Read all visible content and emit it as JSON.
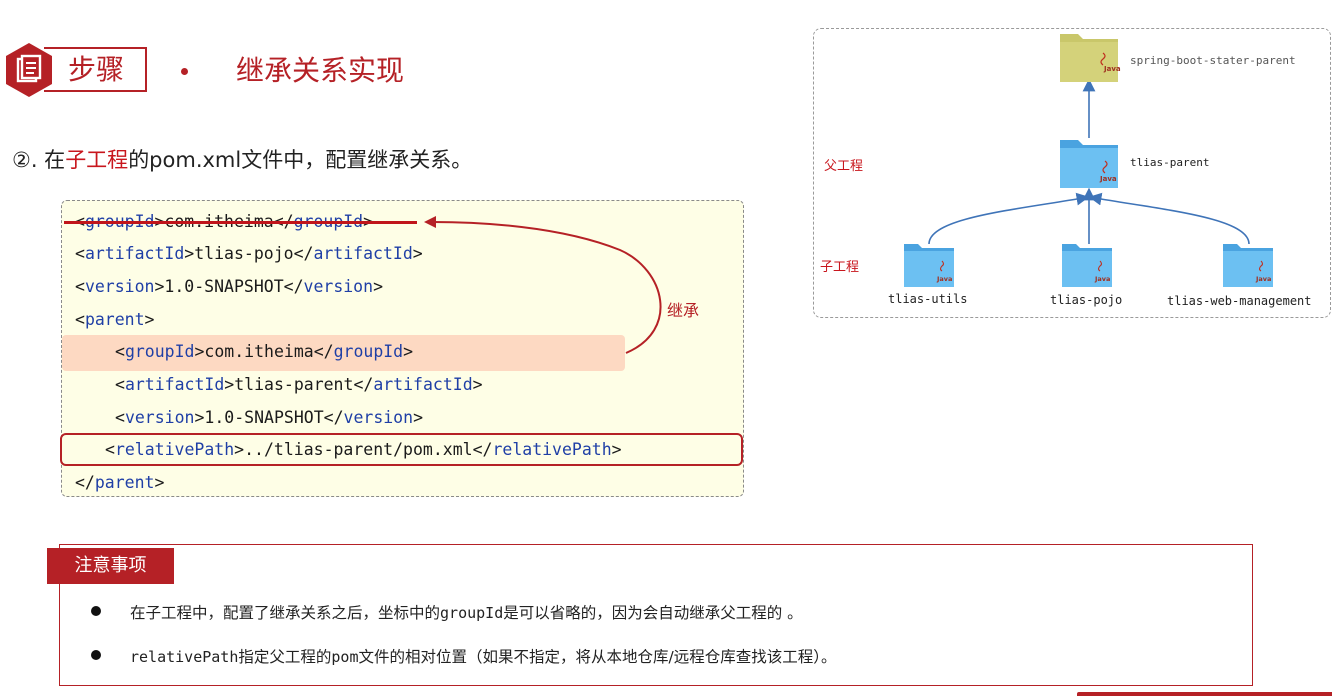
{
  "header": {
    "step_label": "步骤",
    "title": "继承关系实现"
  },
  "instruction": {
    "prefix": "②. 在",
    "highlight": "子工程",
    "suffix": "的pom.xml文件中，配置继承关系。"
  },
  "code": {
    "lines": [
      {
        "open": "groupId",
        "text": "com.itheima"
      },
      {
        "open": "artifactId",
        "text": "tlias-pojo"
      },
      {
        "open": "version",
        "text": "1.0-SNAPSHOT"
      },
      {
        "open": "parent",
        "text": ""
      },
      {
        "open": "groupId",
        "text": "com.itheima"
      },
      {
        "open": "artifactId",
        "text": "tlias-parent"
      },
      {
        "open": "version",
        "text": "1.0-SNAPSHOT"
      },
      {
        "open": "relativePath",
        "text": "../tlias-parent/pom.xml"
      },
      {
        "open": "parent",
        "text": ""
      }
    ],
    "inherit_label": "继承"
  },
  "diagram": {
    "root": "spring-boot-stater-parent",
    "parent": "tlias-parent",
    "parent_group_label": "父工程",
    "child_group_label": "子工程",
    "children": [
      "tlias-utils",
      "tlias-pojo",
      "tlias-web-management"
    ],
    "java_badge": "Java",
    "colors": {
      "root_folder": "#c9c76a",
      "folder": "#5fb5ec",
      "arrow": "#3f74b8"
    }
  },
  "notes": {
    "title": "注意事项",
    "items": [
      {
        "a": "在子工程中，配置了继承关系之后，坐标中的",
        "code": "groupId",
        "b": "是可以省略的，因为会自动继承父工程的 。"
      },
      {
        "a": "",
        "code": "relativePath",
        "b": "指定父工程的",
        "code2": "pom",
        "c": "文件的相对位置（如果不指定，将从本地仓库/远程仓库查找该工程）。"
      }
    ]
  },
  "colors": {
    "accent": "#b52126",
    "tag": "#1f3fa6",
    "code_bg": "#fefee6",
    "highlight": "#fdd9c2"
  }
}
